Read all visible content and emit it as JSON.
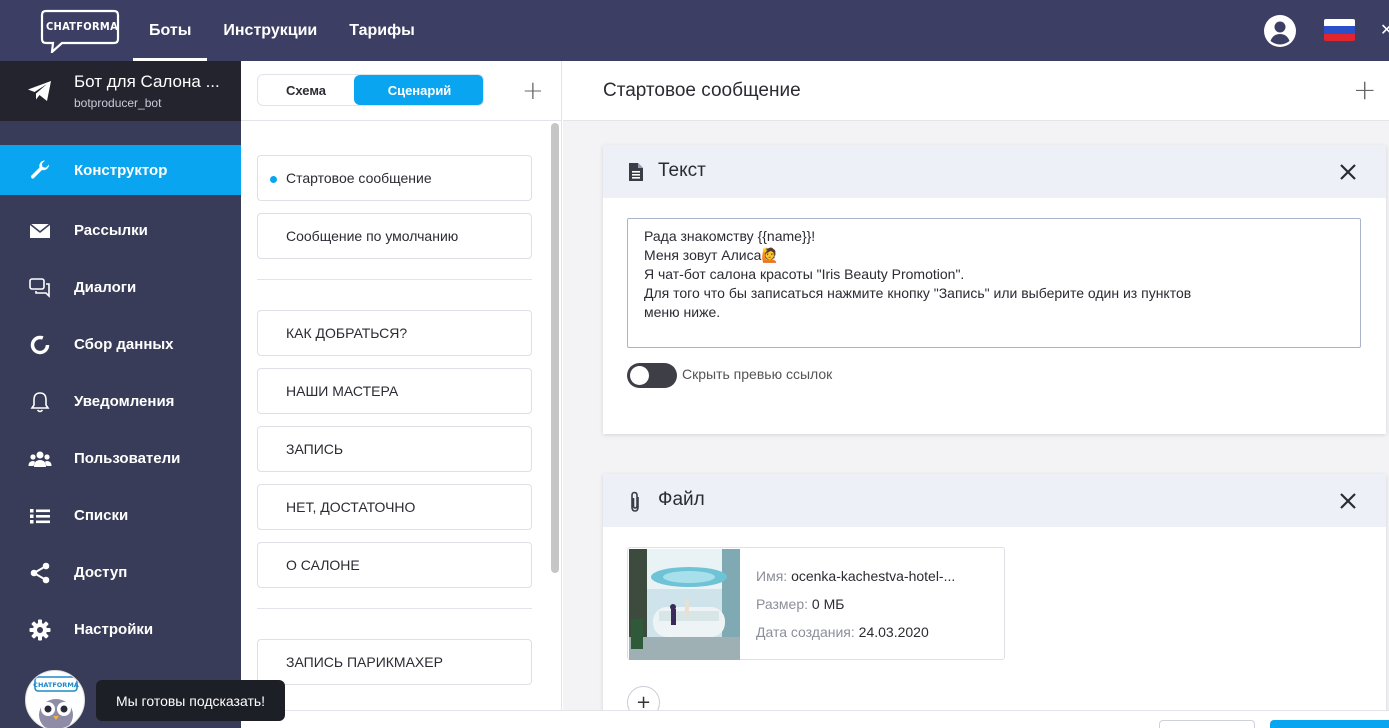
{
  "topbar": {
    "logo_text": "CHATFORMA",
    "nav": [
      {
        "label": "Боты",
        "active": true
      },
      {
        "label": "Инструкции",
        "active": false
      },
      {
        "label": "Тарифы",
        "active": false
      }
    ],
    "user_icon": "user-circle-icon",
    "flag": "russian-flag-icon"
  },
  "sidebar": {
    "bot_name": "Бот для Салона ...",
    "bot_login": "botproducer_bot",
    "items": [
      {
        "label": "Конструктор",
        "icon": "wrench-icon",
        "active": true
      },
      {
        "label": "Рассылки",
        "icon": "envelope-icon"
      },
      {
        "label": "Диалоги",
        "icon": "chat-icon"
      },
      {
        "label": "Сбор данных",
        "icon": "donut-chart-icon"
      },
      {
        "label": "Уведомления",
        "icon": "bell-icon"
      },
      {
        "label": "Пользователи",
        "icon": "users-icon"
      },
      {
        "label": "Списки",
        "icon": "list-icon"
      },
      {
        "label": "Доступ",
        "icon": "share-icon"
      },
      {
        "label": "Настройки",
        "icon": "gear-icon"
      }
    ]
  },
  "scenario": {
    "tab_schema": "Схема",
    "tab_scenario": "Сценарий",
    "group1": [
      "Стартовое сообщение",
      "Сообщение по умолчанию"
    ],
    "group2": [
      "КАК ДОБРАТЬСЯ?",
      "НАШИ МАСТЕРА",
      "ЗАПИСЬ",
      "НЕТ, ДОСТАТОЧНО",
      "О САЛОНЕ"
    ],
    "group3": [
      "ЗАПИСЬ ПАРИКМАХЕР"
    ]
  },
  "main": {
    "title": "Стартовое сообщение",
    "text_card": {
      "title": "Текст",
      "content": "Рада знакомству {{name}}!\nМеня зовут Алиса🙋\nЯ чат-бот салона красоты \"Iris Beauty Promotion\".\nДля того что бы записаться нажмите кнопку \"Запись\" или выберите один из пунктов\nменю ниже.",
      "toggle_label": "Скрыть превью ссылок",
      "toggle_on": false
    },
    "file_card": {
      "title": "Файл",
      "name_key": "Имя:",
      "name_value": "ocenka-kachestva-hotel-...",
      "size_key": "Размер:",
      "size_value": "0 МБ",
      "date_key": "Дата создания:",
      "date_value": "24.03.2020",
      "add_label": "+"
    }
  },
  "help": {
    "text": "Мы готовы подсказать!"
  },
  "colors": {
    "topbar": "#3c3f63",
    "sidebar": "#393c58",
    "accent": "#0aa5f0"
  }
}
